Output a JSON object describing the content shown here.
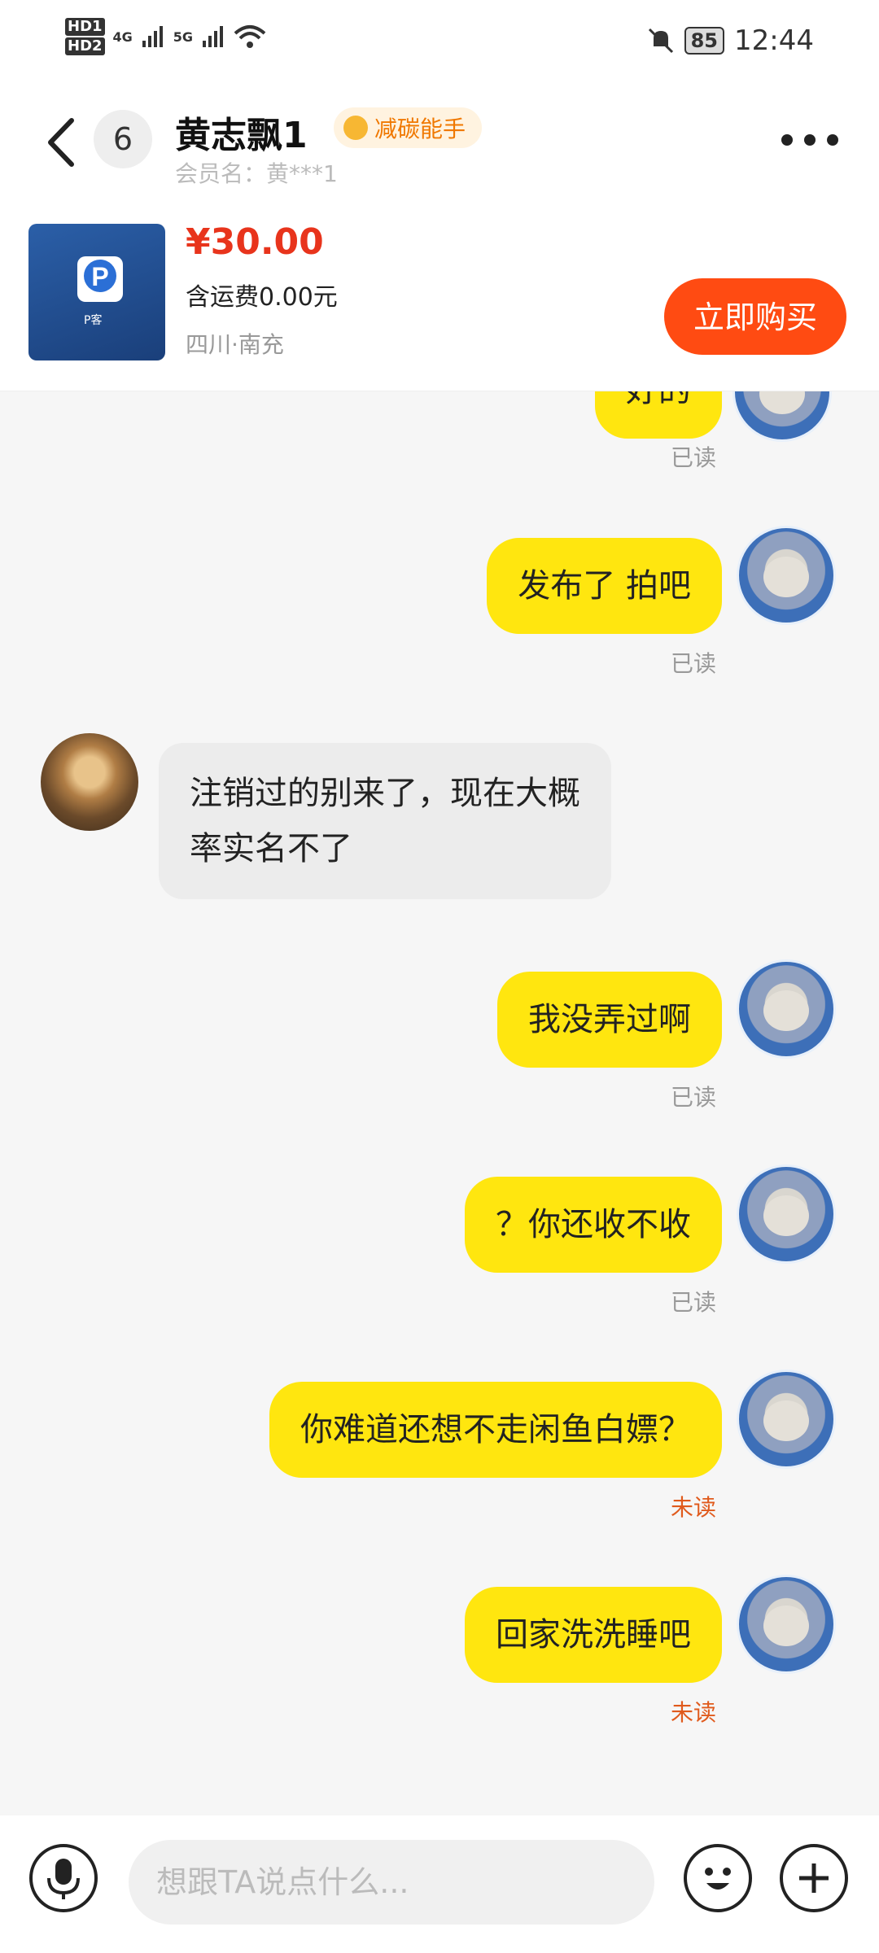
{
  "status_bar": {
    "hd1": "HD1",
    "hd2": "HD2",
    "net1": "4G",
    "net2": "5G",
    "battery": "85",
    "time": "12:44"
  },
  "header": {
    "unread_count": "6",
    "name": "黄志飘1",
    "badge": "减碳能手",
    "member": "会员名：黄***1"
  },
  "product": {
    "price": "¥30.00",
    "shipping": "含运费0.00元",
    "location": "四川·南充",
    "buy_label": "立即购买",
    "image_caption": "P客"
  },
  "messages": [
    {
      "from": "me",
      "text": "好的",
      "status": "已读"
    },
    {
      "from": "me",
      "text": "发布了 拍吧",
      "status": "已读"
    },
    {
      "from": "them",
      "text": "注销过的别来了，现在大概率实名不了"
    },
    {
      "from": "me",
      "text": "我没弄过啊",
      "status": "已读"
    },
    {
      "from": "me",
      "text": "？你还收不收",
      "status": "已读"
    },
    {
      "from": "me",
      "text": "你难道还想不走闲鱼白嫖？",
      "status": "未读"
    },
    {
      "from": "me",
      "text": "回家洗洗睡吧",
      "status": "未读"
    }
  ],
  "input": {
    "placeholder": "想跟TA说点什么..."
  },
  "colors": {
    "accent": "#ff4b12",
    "bubble_me": "#ffe60f",
    "price": "#e8341c",
    "unread": "#e05a1c"
  }
}
